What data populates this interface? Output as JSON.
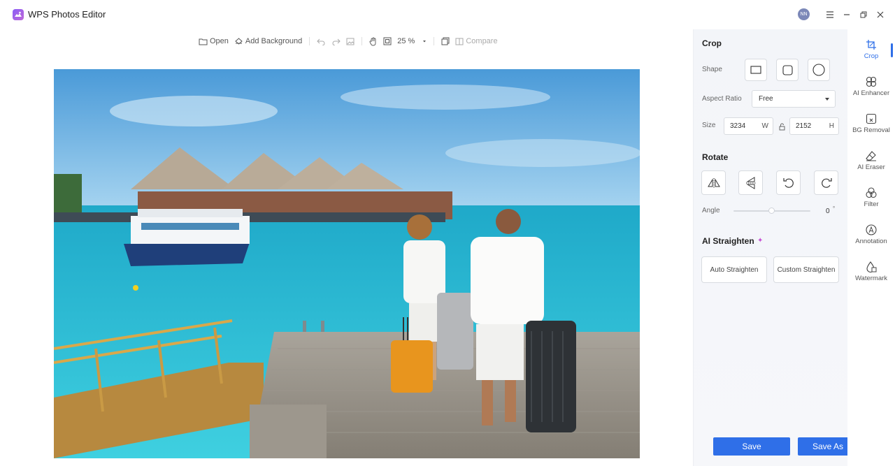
{
  "app": {
    "title": "WPS Photos Editor",
    "avatar_initials": "NN"
  },
  "toolbar": {
    "open_label": "Open",
    "add_background_label": "Add Background",
    "zoom_value": "25 %",
    "compare_label": "Compare"
  },
  "crop": {
    "title": "Crop",
    "shape_label": "Shape",
    "aspect_ratio_label": "Aspect Ratio",
    "aspect_ratio_value": "Free",
    "size_label": "Size",
    "width_value": "3234",
    "width_unit": "W",
    "height_value": "2152",
    "height_unit": "H"
  },
  "rotate": {
    "title": "Rotate",
    "angle_label": "Angle",
    "angle_value": "0",
    "angle_unit": "°"
  },
  "straighten": {
    "title": "AI Straighten",
    "sparkle": "✦",
    "auto_label": "Auto Straighten",
    "custom_label": "Custom Straighten"
  },
  "actions": {
    "save_label": "Save",
    "save_as_label": "Save As"
  },
  "sidenav": {
    "items": [
      {
        "label": "Crop",
        "icon": "crop-icon",
        "active": true
      },
      {
        "label": "AI Enhancer",
        "icon": "ai-enhancer-icon"
      },
      {
        "label": "BG Removal",
        "icon": "bg-removal-icon"
      },
      {
        "label": "AI Eraser",
        "icon": "eraser-icon"
      },
      {
        "label": "Filter",
        "icon": "filter-icon"
      },
      {
        "label": "Annotation",
        "icon": "annotation-icon"
      },
      {
        "label": "Watermark",
        "icon": "watermark-icon"
      }
    ]
  },
  "colors": {
    "accent": "#2f6fe8",
    "sparkle": "#c64fd4",
    "brand": "#8a5cf6"
  }
}
